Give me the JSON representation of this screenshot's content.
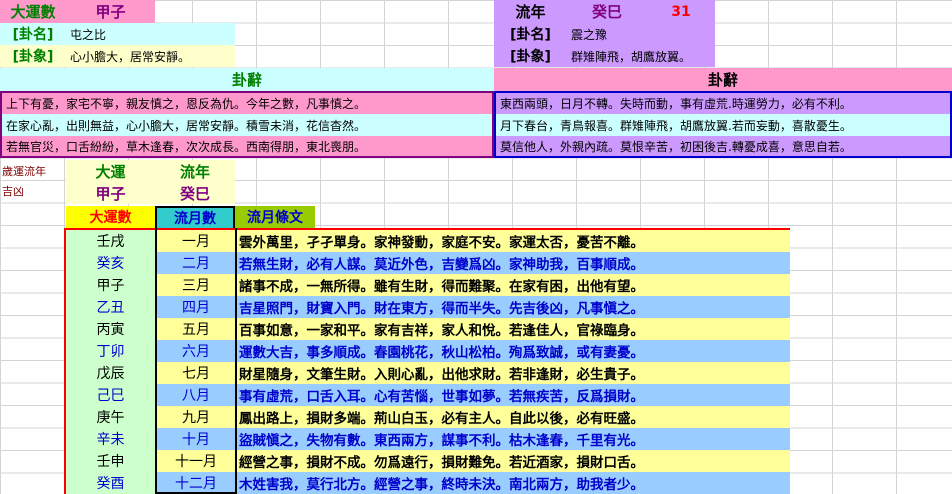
{
  "left_header": {
    "label": "大運數",
    "value": "甲子",
    "gua_name_label": "[卦名]",
    "gua_name": "屯之比",
    "gua_image_label": "[卦象]",
    "gua_image": "心小膽大，居常安靜。",
    "ci_title": "卦辭",
    "ci_lines": [
      "上下有憂，家宅不寧，親友慎之，恩反為仇。今年之數，凡事慎之。",
      "在家心亂，出則無益，心小膽大，居常安靜。積雪未消，花信杳然。",
      "若無官災，口舌紛紛，草木逢春，次次成長。西南得朋，東北喪朋。"
    ]
  },
  "right_header": {
    "label": "流年",
    "value": "癸巳",
    "age": "31",
    "gua_name_label": "[卦名]",
    "gua_name": "震之豫",
    "gua_image_label": "[卦象]",
    "gua_image": "群雉陣飛，胡鷹放翼。",
    "ci_title": "卦辭",
    "ci_lines": [
      "東西兩頭，日月不轉。失時而動，事有虛荒.時運勞力，必有不利。",
      "月下春台，青鳥報喜。群雉陣飛，胡鷹放翼.若而妄動，喜散憂生。",
      "莫信他人，外親內疏。莫恨辛苦，初困後吉.轉憂成喜，意思自若。"
    ]
  },
  "side": {
    "line1": "歲運流年",
    "line2": "吉凶",
    "dayun_label": "大運",
    "liunian_label": "流年",
    "dayun_value": "甲子",
    "liunian_value": "癸巳"
  },
  "table": {
    "headers": [
      "大運數",
      "流月數",
      "流月條文"
    ],
    "rows": [
      {
        "ganzhi": "壬戌",
        "month": "一月",
        "text": "雲外萬里，孑孑單身。家神發動，家庭不安。家運太否，憂苦不離。"
      },
      {
        "ganzhi": "癸亥",
        "month": "二月",
        "text": "若無生財，必有人謀。莫近外色，吉變爲凶。家神助我，百事順成。"
      },
      {
        "ganzhi": "甲子",
        "month": "三月",
        "text": "諸事不成，一無所得。雖有生財，得而難聚。在家有困，出他有望。"
      },
      {
        "ganzhi": "乙丑",
        "month": "四月",
        "text": "吉星照門，財寶入門。財在東方，得而半失。先吉後凶，凡事愼之。"
      },
      {
        "ganzhi": "丙寅",
        "month": "五月",
        "text": "百事如意，一家和平。家有吉祥，家人和悅。若逢佳人，官祿臨身。"
      },
      {
        "ganzhi": "丁卯",
        "month": "六月",
        "text": "運數大吉，事多順成。春園桃花，秋山松柏。殉爲致誠，或有妻憂。"
      },
      {
        "ganzhi": "戊辰",
        "month": "七月",
        "text": "財星隨身，文筆生財。入則心亂，出他求財。若非逢財，必生貴子。"
      },
      {
        "ganzhi": "己巳",
        "month": "八月",
        "text": "事有虛荒，口舌入耳。心有苦惱，世事如夢。若無疾苦，反爲損財。"
      },
      {
        "ganzhi": "庚午",
        "month": "九月",
        "text": "鳳出路上，損財多端。荊山白玉，必有主人。自此以後，必有旺盛。"
      },
      {
        "ganzhi": "辛未",
        "month": "十月",
        "text": "盜賊愼之，失物有數。東西兩方，謀事不利。枯木逢春，千里有光。"
      },
      {
        "ganzhi": "壬申",
        "month": "十一月",
        "text": "經營之事，損財不成。勿爲遠行，損財難免。若近酒家，損財口舌。"
      },
      {
        "ganzhi": "癸酉",
        "month": "十二月",
        "text": "木姓害我，莫行北方。經營之事，終時未決。南北兩方，助我者少。"
      }
    ]
  },
  "colors": {
    "pink": "#ff99cc",
    "lavender": "#cc99ff",
    "cyan": "#ccffff",
    "yellow": "#ffff99",
    "light_green": "#ccffcc",
    "light_blue": "#99ccff",
    "green_text": "#008000",
    "purple_text": "#800080",
    "blue_text": "#0000cc",
    "red_border": "#ff0000",
    "blue_border": "#0000cc"
  }
}
